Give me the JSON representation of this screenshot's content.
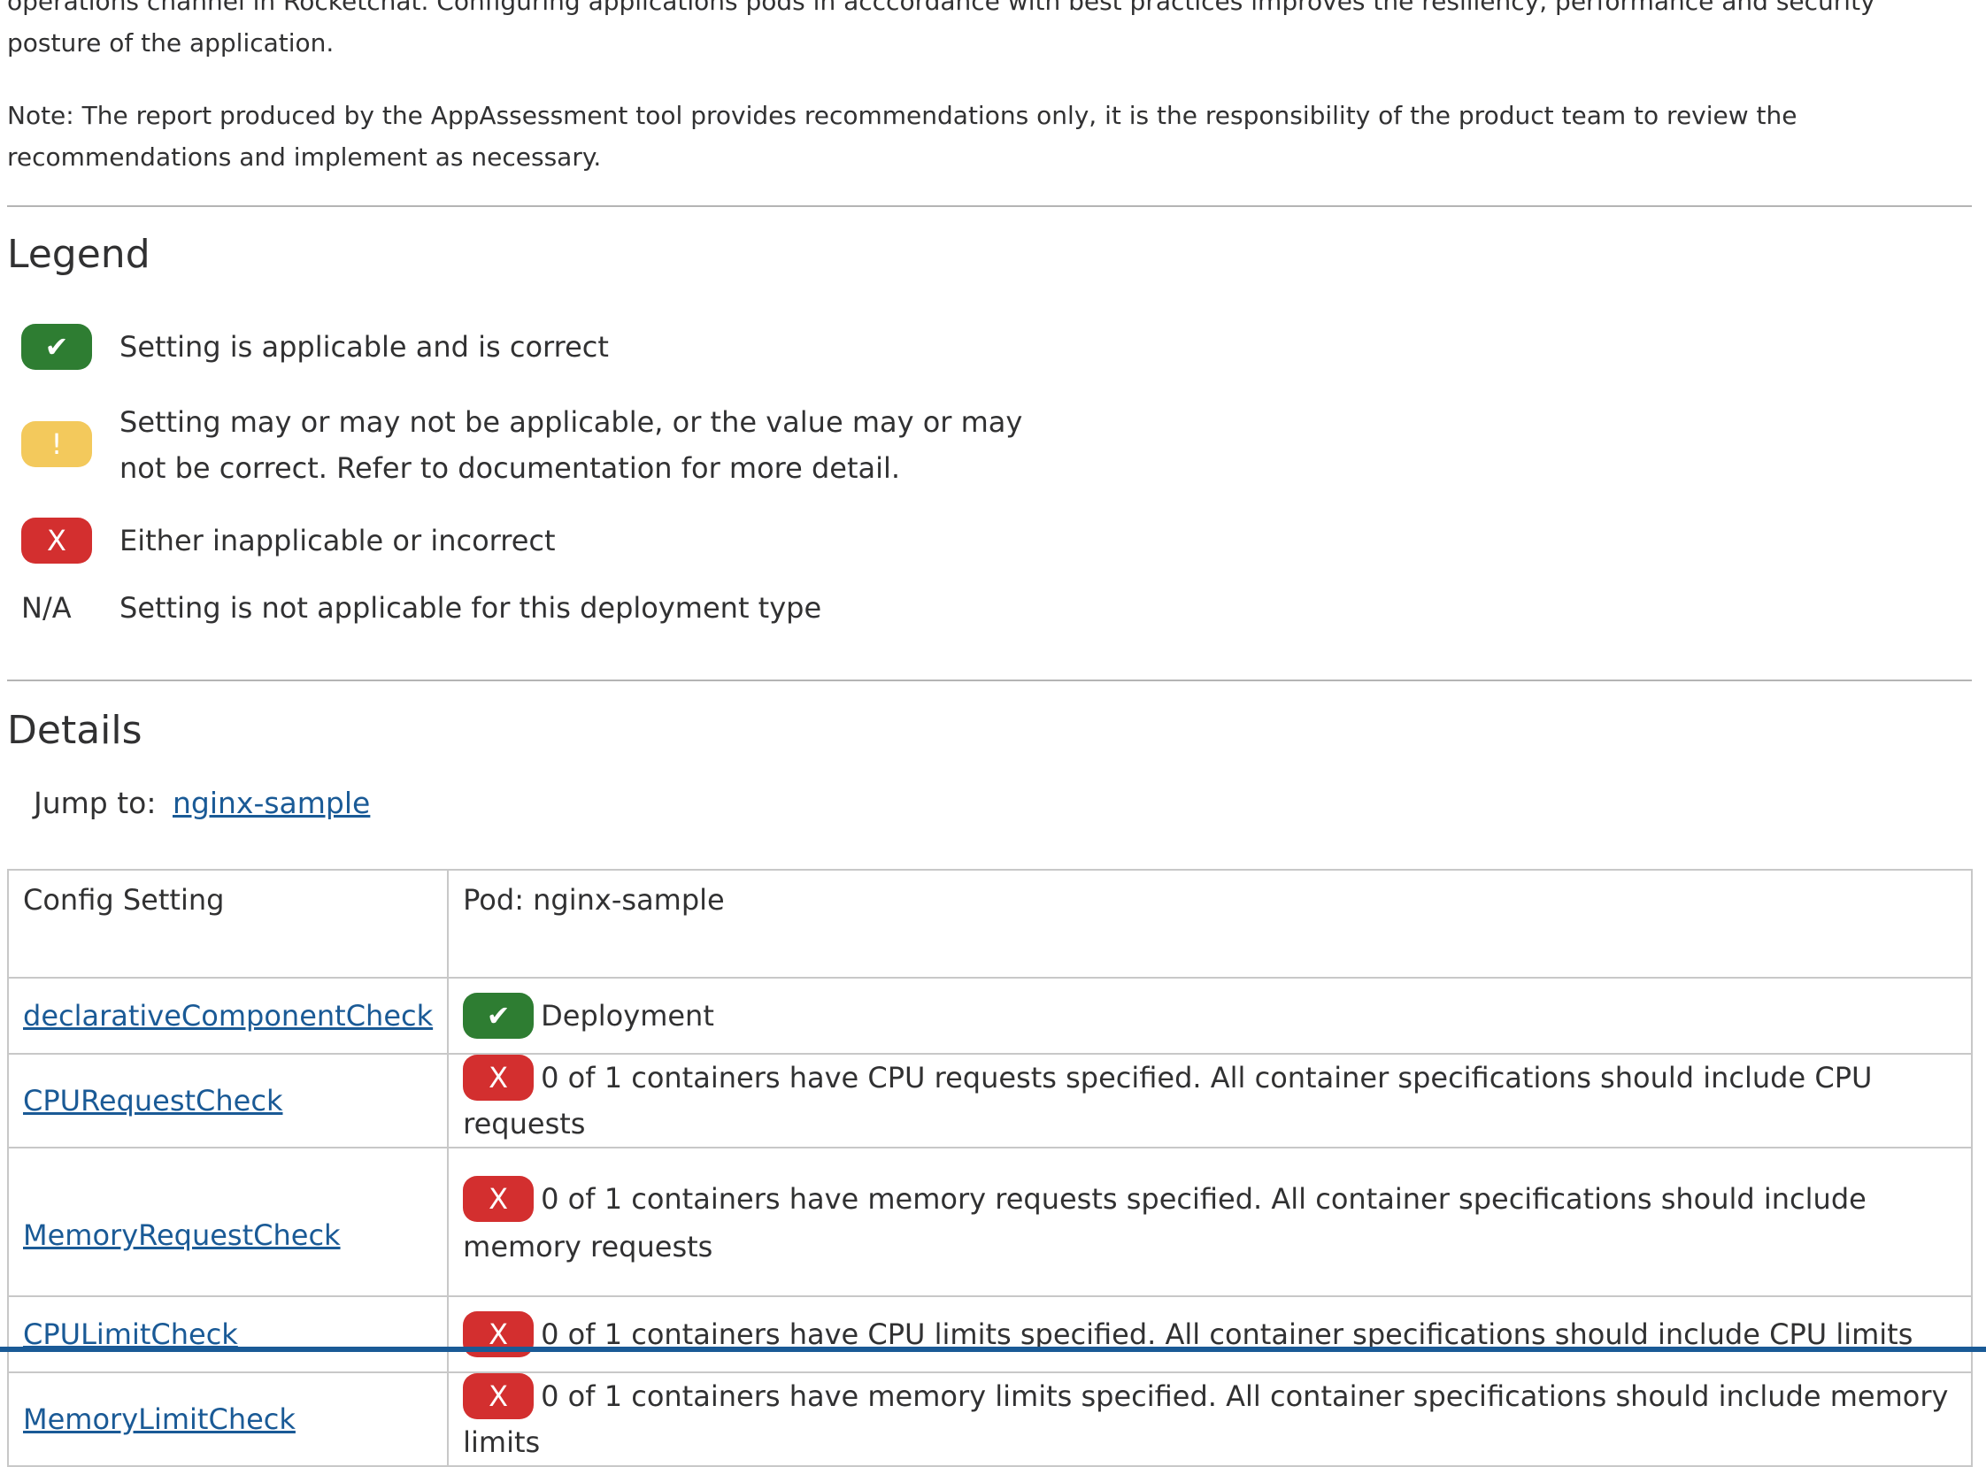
{
  "intro": {
    "text": "operations channel in Rocketchat. Configuring applications pods in acccordance with best practices improves the resiliency, performance and security posture of the application."
  },
  "note": {
    "text": "Note: The report produced by the AppAssessment tool provides recommendations only, it is the responsibility of the product team to review the recommendations and implement as necessary."
  },
  "legend": {
    "title": "Legend",
    "items": [
      {
        "badge": "✔",
        "status": "pass",
        "text": "Setting is applicable and is correct"
      },
      {
        "badge": "!",
        "status": "warning",
        "text_line1": "Setting may or may not be applicable, or the value may or may",
        "text_line2": "not be correct. Refer to documentation for more detail."
      },
      {
        "badge": "X",
        "status": "fail",
        "text": "Either inapplicable or incorrect"
      },
      {
        "badge": "N/A",
        "status": "na",
        "text": "Setting is not applicable for this deployment type"
      }
    ]
  },
  "details": {
    "title": "Details",
    "jump_label": "Jump to:",
    "jump_link": "nginx-sample",
    "table": {
      "headers": [
        "Config Setting",
        "Pod: nginx-sample"
      ],
      "rows": [
        {
          "setting": "declarativeComponentCheck",
          "badge": "✔",
          "status": "pass",
          "result": "Deployment"
        },
        {
          "setting": "CPURequestCheck",
          "badge": "X",
          "status": "fail",
          "result": "0 of 1 containers have CPU requests specified. All container specifications should include CPU requests"
        },
        {
          "setting": "MemoryRequestCheck",
          "badge": "X",
          "status": "fail",
          "result": "0 of 1 containers have memory requests specified. All container specifications should include memory requests"
        },
        {
          "setting": "CPULimitCheck",
          "badge": "X",
          "status": "fail",
          "result": "0 of 1 containers have CPU limits specified. All container specifications should include CPU limits"
        },
        {
          "setting": "MemoryLimitCheck",
          "badge": "X",
          "status": "fail",
          "result": "0 of 1 containers have memory limits specified. All container specifications should include memory limits"
        }
      ]
    }
  },
  "colors": {
    "pass": "#2e7d32",
    "warning": "#f3c95c",
    "fail": "#d32f2f",
    "link": "#1a5a96",
    "text": "#313132",
    "rule": "#b4b4b4"
  }
}
